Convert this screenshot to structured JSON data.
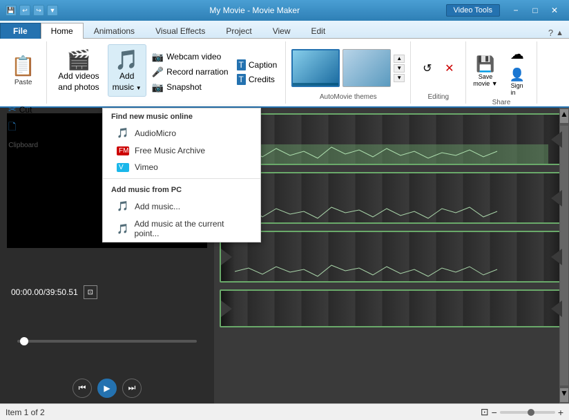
{
  "window": {
    "title": "My Movie - Movie Maker",
    "badge": "Video Tools",
    "minimize_label": "−",
    "maximize_label": "□",
    "close_label": "✕"
  },
  "tabs": {
    "file": "File",
    "home": "Home",
    "animations": "Animations",
    "visual_effects": "Visual Effects",
    "project": "Project",
    "view": "View",
    "edit": "Edit"
  },
  "ribbon": {
    "clipboard_label": "Clipboard",
    "paste_label": "Paste",
    "cut_label": "Cut",
    "copy_label": "Copy",
    "add_videos_line1": "Add videos",
    "add_videos_line2": "and photos",
    "add_music_line1": "Add",
    "add_music_line2": "music",
    "webcam_label": "Webcam video",
    "narration_label": "Record narration",
    "snapshot_label": "Snapshot",
    "caption_label": "Caption",
    "credits_label": "Credits",
    "themes_label": "AutoMovie themes",
    "editing_label": "Editing",
    "share_label": "Share",
    "save_movie_label": "Save\nmovie",
    "sign_in_label": "Sign\nin"
  },
  "dropdown": {
    "find_online_header": "Find new music online",
    "audiomicro_label": "AudioMicro",
    "free_music_label": "Free Music Archive",
    "vimeo_label": "Vimeo",
    "from_pc_header": "Add music from PC",
    "add_music_label": "Add music...",
    "add_at_point_label": "Add music at the current point..."
  },
  "preview": {
    "time": "00:00.00/39:50.51"
  },
  "status": {
    "item_label": "Item 1 of 2"
  },
  "icons": {
    "film": "🎬",
    "music": "🎵",
    "webcam": "📷",
    "microphone": "🎤",
    "camera": "📷",
    "text_caption": "T",
    "credits": "T",
    "paste": "📋",
    "cut": "✂",
    "copy": "🗋",
    "save": "💾",
    "cloud": "☁",
    "user": "👤",
    "play": "▶",
    "prev": "⏮",
    "next": "⏭",
    "wand": "✦",
    "x_mark": "✕",
    "chevron_up": "▲",
    "chevron_down": "▼",
    "chevron_left": "◀",
    "chevron_right": "▶",
    "zoom_in": "+",
    "zoom_out": "−",
    "fit": "⊡"
  }
}
